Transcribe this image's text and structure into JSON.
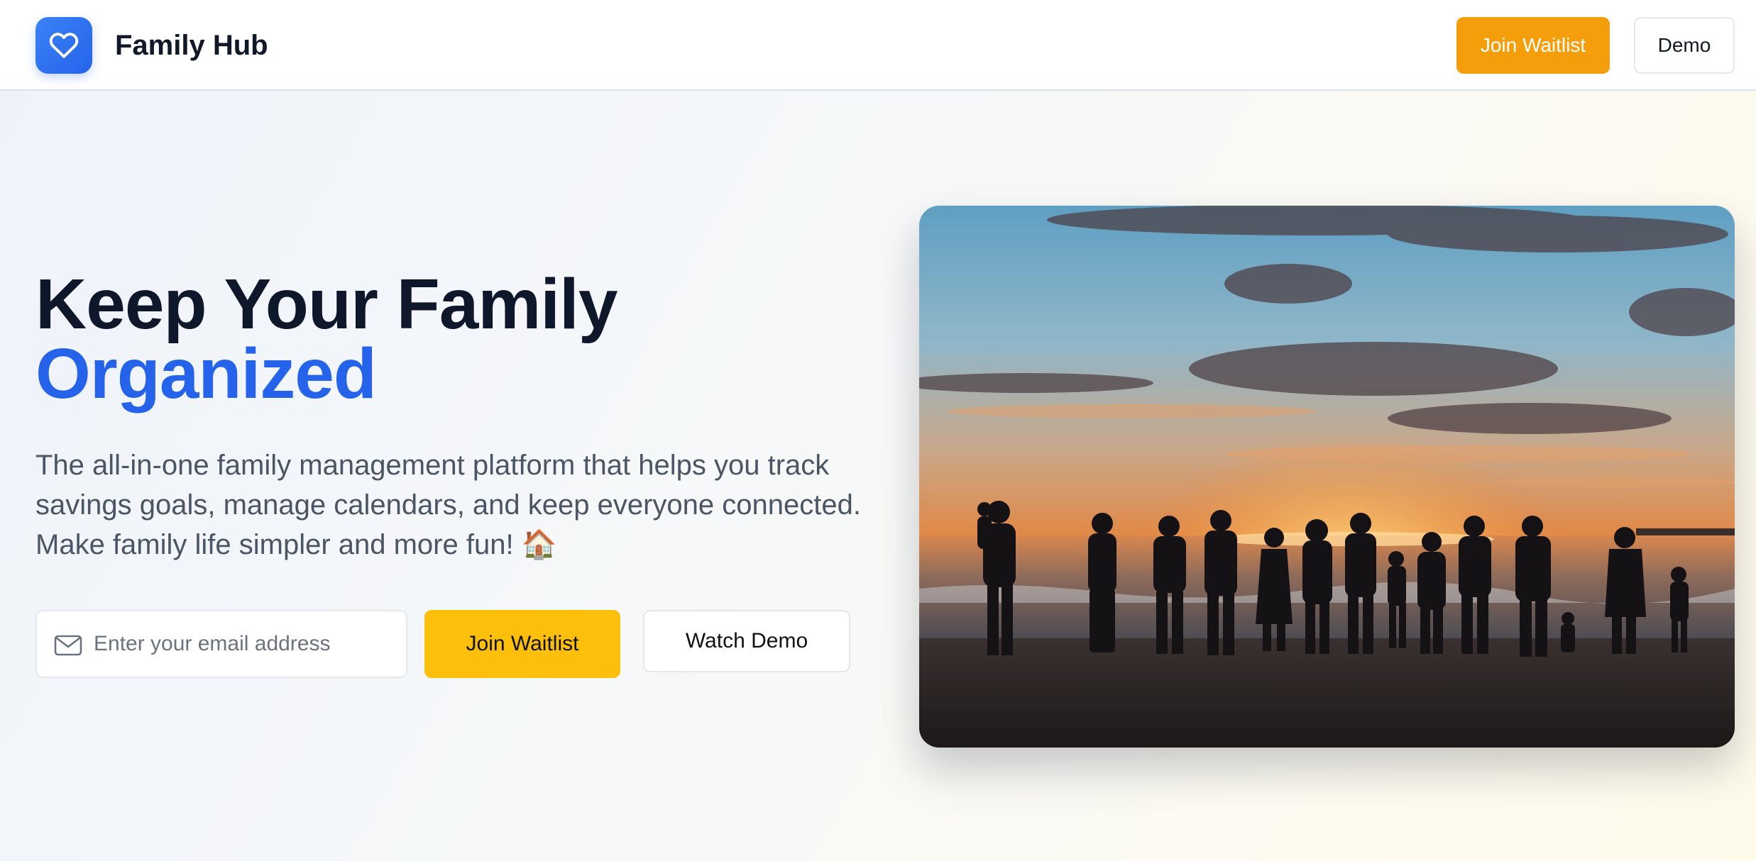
{
  "header": {
    "brand": "Family Hub",
    "logo_icon": "heart-icon",
    "join_label": "Join Waitlist",
    "demo_label": "Demo"
  },
  "hero": {
    "headline_line1": "Keep Your Family",
    "headline_accent": "Organized",
    "subtitle": "The all-in-one family management platform that helps you track savings goals, manage calendars, and keep everyone connected. Make family life simpler and more fun! 🏠",
    "email_placeholder": "Enter your email address",
    "email_icon": "mail-icon",
    "join_label": "Join Waitlist",
    "demo_label": "Watch Demo",
    "image_subject": "family-silhouette-beach-sunset"
  },
  "colors": {
    "brand_blue": "#2563eb",
    "header_join_orange": "#f59e0b",
    "cta_yellow": "#fcbf0b",
    "heading_dark": "#0f172a",
    "body_gray": "#4b5563"
  }
}
